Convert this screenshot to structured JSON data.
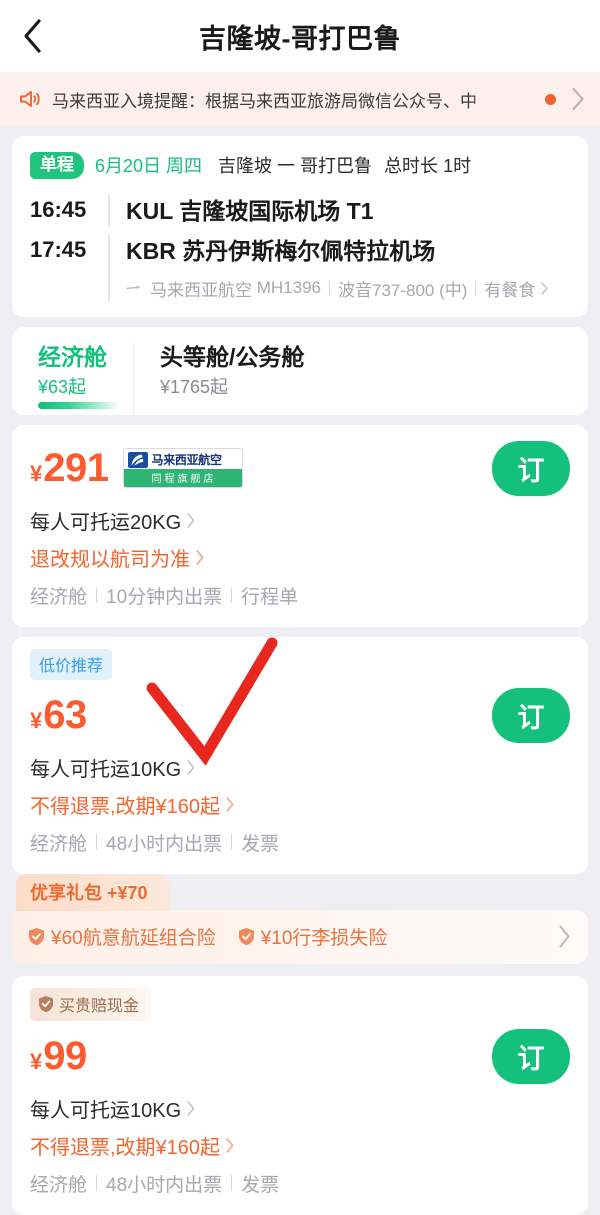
{
  "nav": {
    "back_icon": "chevron-left-icon",
    "title": "吉隆坡-哥打巴鲁"
  },
  "notice": {
    "icon": "megaphone-icon",
    "text": "马来西亚入境提醒：根据马来西亚旅游局微信公众号、中",
    "dot_color": "#F4632B",
    "arrow_icon": "chevron-right-icon"
  },
  "flight": {
    "trip_type": "单程",
    "date": "6月20日 周四",
    "route": "吉隆坡 一 哥打巴鲁",
    "duration": "总时长 1时",
    "legs": [
      {
        "time": "16:45",
        "code": "KUL",
        "airport": "吉隆坡国际机场 T1"
      },
      {
        "time": "17:45",
        "code": "KBR",
        "airport": "苏丹伊斯梅尔佩特拉机场"
      }
    ],
    "meta": {
      "plane_icon": "airplane-icon",
      "airline": "马来西亚航空",
      "flight_no": "MH1396",
      "aircraft": "波音737-800 (中)",
      "meal": "有餐食",
      "arrow_icon": "chevron-right-icon"
    }
  },
  "class_tabs": [
    {
      "name": "经济舱",
      "price": "¥63起",
      "active": true
    },
    {
      "name": "头等舱/公务舱",
      "price": "¥1765起",
      "active": false
    }
  ],
  "offers": [
    {
      "tag": null,
      "currency": "¥",
      "price": "291",
      "logo": {
        "mark_icon": "malaysia-airlines-logo-icon",
        "name": "马来西亚航空",
        "store": "同程旗舰店"
      },
      "book_label": "订",
      "baggage": "每人可托运20KG",
      "refund": "退改规以航司为准",
      "attrs": [
        "经济舱",
        "10分钟内出票",
        "行程单"
      ]
    },
    {
      "tag": {
        "type": "lowprice",
        "label": "低价推荐"
      },
      "currency": "¥",
      "price": "63",
      "logo": null,
      "book_label": "订",
      "baggage": "每人可托运10KG",
      "refund": "不得退票,改期¥160起",
      "attrs": [
        "经济舱",
        "48小时内出票",
        "发票"
      ],
      "gift": {
        "title": "优享礼包 +¥70",
        "items": [
          {
            "icon": "shield-check-icon",
            "label": "¥60航意航延组合险"
          },
          {
            "icon": "shield-check-icon",
            "label": "¥10行李损失险"
          }
        ],
        "arrow_icon": "chevron-right-icon"
      }
    },
    {
      "tag": {
        "type": "guarantee",
        "label": "买贵赔现金",
        "icon": "shield-check-icon"
      },
      "currency": "¥",
      "price": "99",
      "logo": null,
      "book_label": "订",
      "baggage": "每人可托运10KG",
      "refund": "不得退票,改期¥160起",
      "attrs": [
        "经济舱",
        "48小时内出票",
        "发票"
      ]
    }
  ],
  "annotation": {
    "shape": "red-checkmark",
    "color": "#E8281E"
  },
  "colors": {
    "brand_green": "#13C07C",
    "price_orange": "#FB5B2E",
    "page_bg": "#EFEFF3",
    "notice_bg": "#FDF0EC"
  }
}
